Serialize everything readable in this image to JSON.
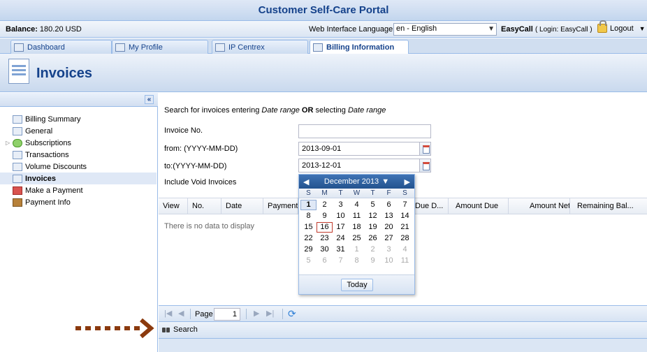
{
  "app": {
    "title": "Customer Self-Care Portal"
  },
  "infobar": {
    "balance_label": "Balance:",
    "balance_value": "180.20 USD",
    "language_label": "Web Interface Language:",
    "language_value": "en - English",
    "user_name": "EasyCall",
    "user_login": "( Login: EasyCall )",
    "logout_label": "Logout"
  },
  "tabs": [
    {
      "label": "Dashboard",
      "icon": "dashboard-icon"
    },
    {
      "label": "My Profile",
      "icon": "profile-icon"
    },
    {
      "label": "IP Centrex",
      "icon": "gear-icon"
    },
    {
      "label": "Billing Information",
      "icon": "document-icon",
      "active": true
    }
  ],
  "header": {
    "title": "Invoices"
  },
  "sidebar": {
    "collapse_label": "«",
    "items": [
      {
        "label": "Billing Summary",
        "icon": "chart-icon"
      },
      {
        "label": "General",
        "icon": "gear-icon"
      },
      {
        "label": "Subscriptions",
        "icon": "subscriptions-icon",
        "expandable": true
      },
      {
        "label": "Transactions",
        "icon": "transactions-icon"
      },
      {
        "label": "Volume Discounts",
        "icon": "discount-icon"
      },
      {
        "label": "Invoices",
        "icon": "invoice-icon",
        "selected": true
      },
      {
        "label": "Make a Payment",
        "icon": "payment-icon"
      },
      {
        "label": "Payment Info",
        "icon": "payment-info-icon"
      }
    ]
  },
  "search_form": {
    "hint_prefix": "Search for invoices entering ",
    "hint_em1": "Date range",
    "hint_or": " OR ",
    "hint_mid": "selecting ",
    "hint_em2": "Date range",
    "invoice_no_label": "Invoice No.",
    "invoice_no_value": "",
    "from_label": "from: (YYYY-MM-DD)",
    "from_value": "2013-09-01",
    "to_label": "to:(YYYY-MM-DD)",
    "to_value": "2013-12-01",
    "void_label": "Include Void Invoices"
  },
  "grid": {
    "columns": [
      "View",
      "No.",
      "Date",
      "Payment",
      "Due D...",
      "Amount Due",
      "Amount Net",
      "Remaining Bal..."
    ],
    "empty_text": "There is no data to display"
  },
  "pager": {
    "page_label": "Page",
    "page_value": "1"
  },
  "search_bar": {
    "label": "Search"
  },
  "datepicker": {
    "month_label": "December 2013",
    "weekdays": [
      "S",
      "M",
      "T",
      "W",
      "T",
      "F",
      "S"
    ],
    "days": [
      [
        "1",
        "2",
        "3",
        "4",
        "5",
        "6",
        "7"
      ],
      [
        "8",
        "9",
        "10",
        "11",
        "12",
        "13",
        "14"
      ],
      [
        "15",
        "16",
        "17",
        "18",
        "19",
        "20",
        "21"
      ],
      [
        "22",
        "23",
        "24",
        "25",
        "26",
        "27",
        "28"
      ],
      [
        "29",
        "30",
        "31",
        "1",
        "2",
        "3",
        "4"
      ],
      [
        "5",
        "6",
        "7",
        "8",
        "9",
        "10",
        "11"
      ]
    ],
    "selected_day": "1",
    "today_day": "16",
    "today_label": "Today"
  },
  "colors": {
    "accent": "#15428b",
    "header_bg": "#c3d6ee",
    "annotation": "#8b3a0e"
  }
}
